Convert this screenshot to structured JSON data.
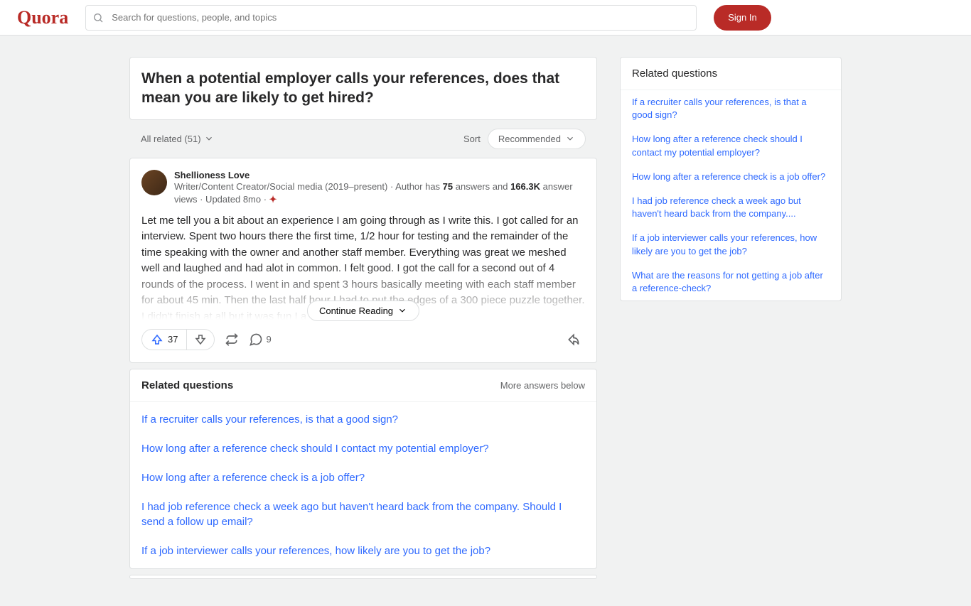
{
  "header": {
    "logo": "Quora",
    "search_placeholder": "Search for questions, people, and topics",
    "signin": "Sign In"
  },
  "question": {
    "title": "When a potential employer calls your references, does that mean you are likely to get hired?"
  },
  "filter": {
    "all_related": "All related (51)",
    "sort_label": "Sort",
    "sort_value": "Recommended"
  },
  "answer": {
    "author": "Shellioness Love",
    "bio_pre": "Writer/Content Creator/Social media (2019–present) · Author has ",
    "answers_count": "75",
    "mid1": " answers and ",
    "views_count": "166.3K",
    "mid2": " answer views · Updated 8mo · ",
    "body": "Let me tell you a bit about an experience I am going through as I write this. I got called for an interview. Spent two hours there the first time, 1/2 hour for testing and the remainder of the time speaking with the owner and another staff member. Everything was great we meshed well and laughed and had alot in common. I felt good. I got the call for a second out of 4 rounds of the process. I went in and spent 3 hours basically meeting with each staff member for about 45 min. Then the last half hour I had to put the edges of a 300 piece puzzle together. I didn't finish at all but it was fun I a",
    "continue": "Continue Reading",
    "upvotes": "37",
    "comments": "9"
  },
  "related_inline": {
    "heading": "Related questions",
    "more": "More answers below",
    "items": [
      "If a recruiter calls your references, is that a good sign?",
      "How long after a reference check should I contact my potential employer?",
      "How long after a reference check is a job offer?",
      "I had job reference check a week ago but haven't heard back from the company. Should I send a follow up email?",
      "If a job interviewer calls your references, how likely are you to get the job?"
    ]
  },
  "sidebar": {
    "heading": "Related questions",
    "items": [
      "If a recruiter calls your references, is that a good sign?",
      "How long after a reference check should I contact my potential employer?",
      "How long after a reference check is a job offer?",
      "I had job reference check a week ago but haven't heard back from the company....",
      "If a job interviewer calls your references, how likely are you to get the job?",
      "What are the reasons for not getting a job after a reference-check?"
    ]
  }
}
